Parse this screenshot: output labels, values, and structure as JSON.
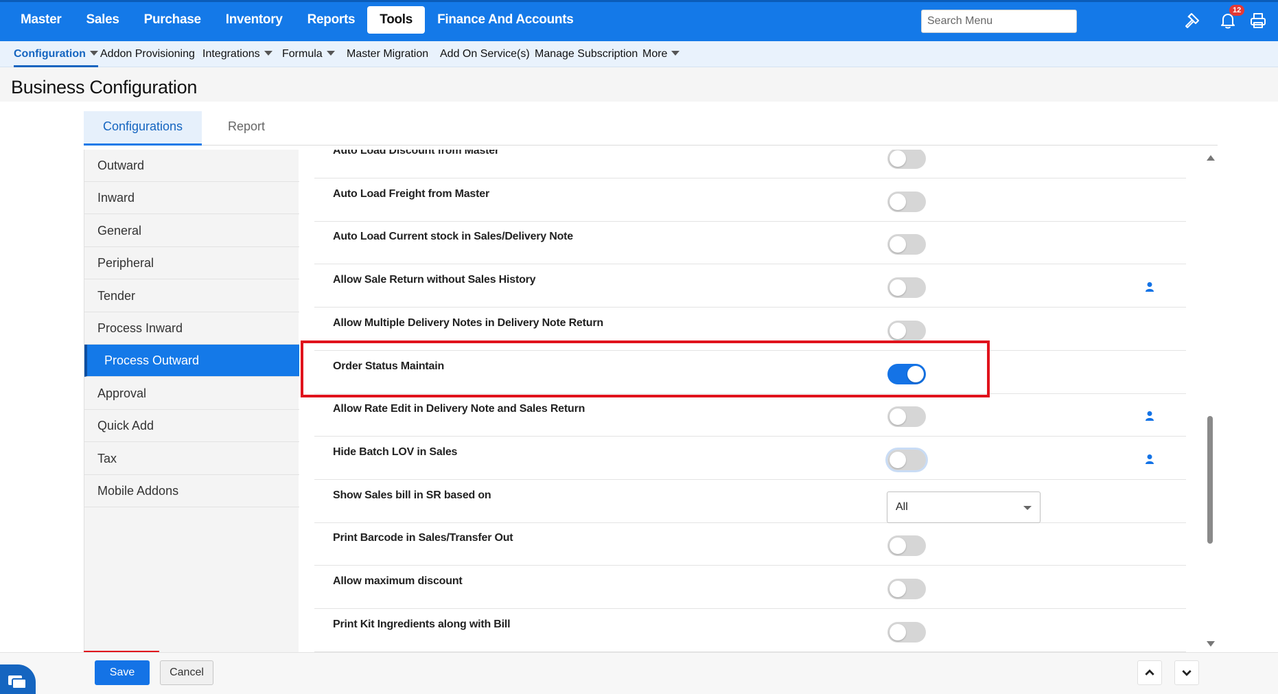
{
  "topnav": {
    "items": [
      {
        "label": "Master"
      },
      {
        "label": "Sales"
      },
      {
        "label": "Purchase"
      },
      {
        "label": "Inventory"
      },
      {
        "label": "Reports"
      },
      {
        "label": "Tools"
      },
      {
        "label": "Finance And Accounts"
      }
    ],
    "active": "Tools",
    "search_placeholder": "Search Menu",
    "notification_count": "12",
    "icons": [
      "hammer-icon",
      "bell-icon",
      "printer-icon"
    ]
  },
  "subnav": {
    "items": [
      {
        "label": "Configuration",
        "dropdown": true
      },
      {
        "label": "Addon Provisioning",
        "dropdown": false
      },
      {
        "label": "Integrations",
        "dropdown": true
      },
      {
        "label": "Formula",
        "dropdown": true
      },
      {
        "label": "Master Migration",
        "dropdown": false
      },
      {
        "label": "Add On Service(s)",
        "dropdown": false
      },
      {
        "label": "Manage Subscription",
        "dropdown": false
      },
      {
        "label": "More",
        "dropdown": true
      }
    ],
    "active": "Configuration"
  },
  "page": {
    "title": "Business Configuration"
  },
  "tabs": [
    {
      "label": "Configurations"
    },
    {
      "label": "Report"
    }
  ],
  "active_tab": "Configurations",
  "sidebar": {
    "items": [
      {
        "label": "Outward"
      },
      {
        "label": "Inward"
      },
      {
        "label": "General"
      },
      {
        "label": "Peripheral"
      },
      {
        "label": "Tender"
      },
      {
        "label": "Process Inward"
      },
      {
        "label": "Process Outward"
      },
      {
        "label": "Approval"
      },
      {
        "label": "Quick Add"
      },
      {
        "label": "Tax"
      },
      {
        "label": "Mobile Addons"
      }
    ],
    "active": "Process Outward"
  },
  "settings": [
    {
      "label": "Auto Load Discount from Master",
      "control": "toggle",
      "on": false,
      "user_icon": false
    },
    {
      "label": "Auto Load Freight from Master",
      "control": "toggle",
      "on": false,
      "user_icon": false
    },
    {
      "label": "Auto Load Current stock in Sales/Delivery Note",
      "control": "toggle",
      "on": false,
      "user_icon": false
    },
    {
      "label": "Allow Sale Return without Sales History",
      "control": "toggle",
      "on": false,
      "user_icon": true
    },
    {
      "label": "Allow Multiple Delivery Notes in Delivery Note Return",
      "control": "toggle",
      "on": false,
      "user_icon": false
    },
    {
      "label": "Order Status Maintain",
      "control": "toggle",
      "on": true,
      "user_icon": false,
      "highlighted": true
    },
    {
      "label": "Allow Rate Edit in Delivery Note and Sales Return",
      "control": "toggle",
      "on": false,
      "user_icon": true
    },
    {
      "label": "Hide Batch LOV in Sales",
      "control": "toggle",
      "on": false,
      "user_icon": true,
      "focused": true
    },
    {
      "label": "Show Sales bill in SR based on",
      "control": "select",
      "value": "All",
      "user_icon": false
    },
    {
      "label": "Print Barcode in Sales/Transfer Out",
      "control": "toggle",
      "on": false,
      "user_icon": false
    },
    {
      "label": "Allow maximum discount",
      "control": "toggle",
      "on": false,
      "user_icon": false
    },
    {
      "label": "Print Kit Ingredients along with Bill",
      "control": "toggle",
      "on": false,
      "user_icon": false
    }
  ],
  "footer": {
    "save_label": "Save",
    "cancel_label": "Cancel"
  },
  "colors": {
    "primary": "#1479e8",
    "toggle_on": "#1473e6",
    "toggle_off": "#d6d6d6",
    "highlight": "#e0131c",
    "badge": "#e53935"
  }
}
